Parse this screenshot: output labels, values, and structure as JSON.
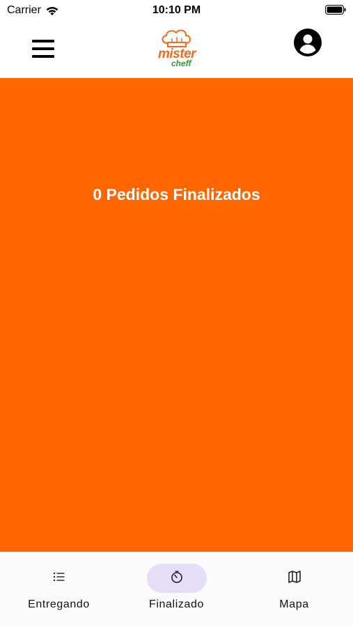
{
  "status_bar": {
    "carrier": "Carrier",
    "time": "10:10 PM"
  },
  "header": {
    "logo_main": "mister",
    "logo_sub": "cheff",
    "menu_icon": "hamburger-icon",
    "profile_icon": "user-circle-icon"
  },
  "main": {
    "summary": "0 Pedidos Finalizados",
    "background_color": "#ff6600"
  },
  "bottom_nav": {
    "active_index": 1,
    "items": [
      {
        "label": "Entregando",
        "icon": "list-icon"
      },
      {
        "label": "Finalizado",
        "icon": "timer-icon"
      },
      {
        "label": "Mapa",
        "icon": "map-icon"
      }
    ]
  }
}
